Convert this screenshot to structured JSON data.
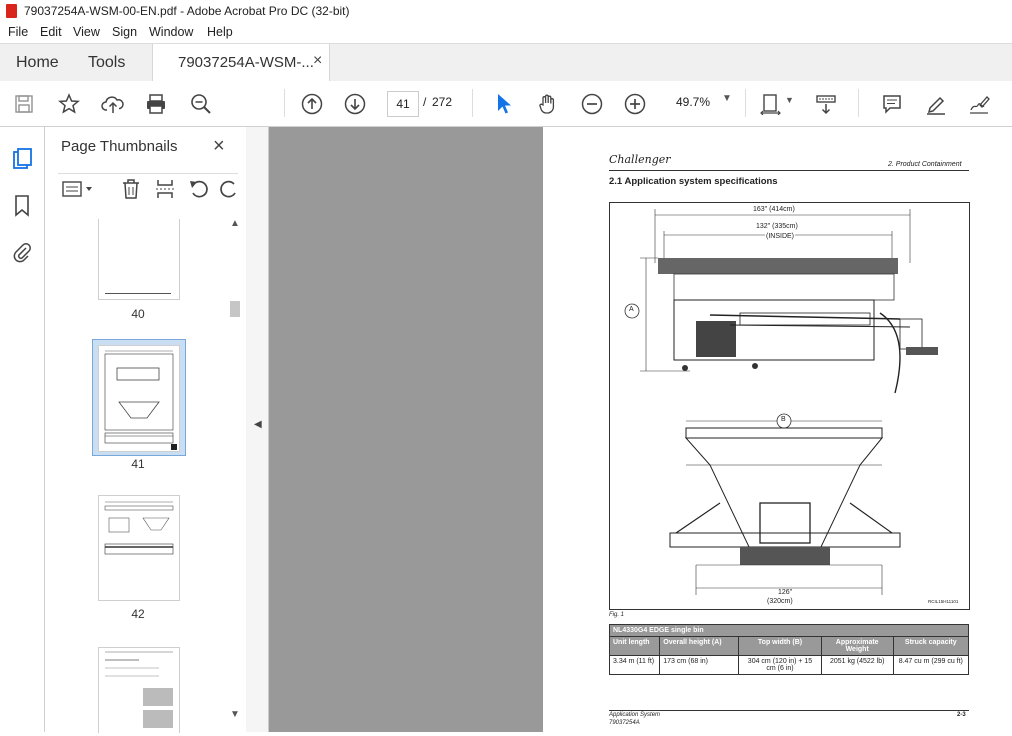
{
  "window": {
    "title": "79037254A-WSM-00-EN.pdf - Adobe Acrobat Pro DC (32-bit)"
  },
  "menu": [
    "File",
    "Edit",
    "View",
    "Sign",
    "Window",
    "Help"
  ],
  "tabs": {
    "home": "Home",
    "tools": "Tools",
    "document": "79037254A-WSM-...",
    "close_glyph": "×"
  },
  "toolbar": {
    "page_current": "41",
    "page_separator": "/",
    "page_total": "272",
    "zoom": "49.7%"
  },
  "panel": {
    "title": "Page Thumbnails",
    "close_glyph": "×",
    "thumbnails": [
      {
        "label": "40"
      },
      {
        "label": "41"
      },
      {
        "label": "42"
      }
    ]
  },
  "document": {
    "brand": "Challenger",
    "chapter": "2. Product Containment",
    "section_title": "2.1  Application system specifications",
    "dim_top_overall": "163\" (414cm)",
    "dim_top_inside_1": "132\" (335cm)",
    "dim_top_inside_2": "(INSIDE)",
    "label_a": "A",
    "label_b": "B",
    "dim_bottom_1": "126\"",
    "dim_bottom_2": "(320cm)",
    "figure_ref": "RCIL15H11101",
    "fig_caption": "Fig. 1",
    "table_title": "NL4330G4 EDGE single bin",
    "table_headers": [
      "Unit length",
      "Overall height (A)",
      "Top width (B)",
      "Approximate Weight",
      "Struck capacity"
    ],
    "table_row": [
      "3.34 m (11 ft)",
      "173 cm (68 in)",
      "304 cm (120 in) + 15 cm (6 in)",
      "2051 kg (4522 lb)",
      "8.47 cu m (299 cu ft)"
    ],
    "footer_left_1": "Application System",
    "footer_left_2": "79037254A",
    "footer_right": "2-3"
  },
  "colors": {
    "accent_blue": "#1473e6",
    "pdf_red": "#d9251c",
    "viewer_gray": "#999999"
  }
}
